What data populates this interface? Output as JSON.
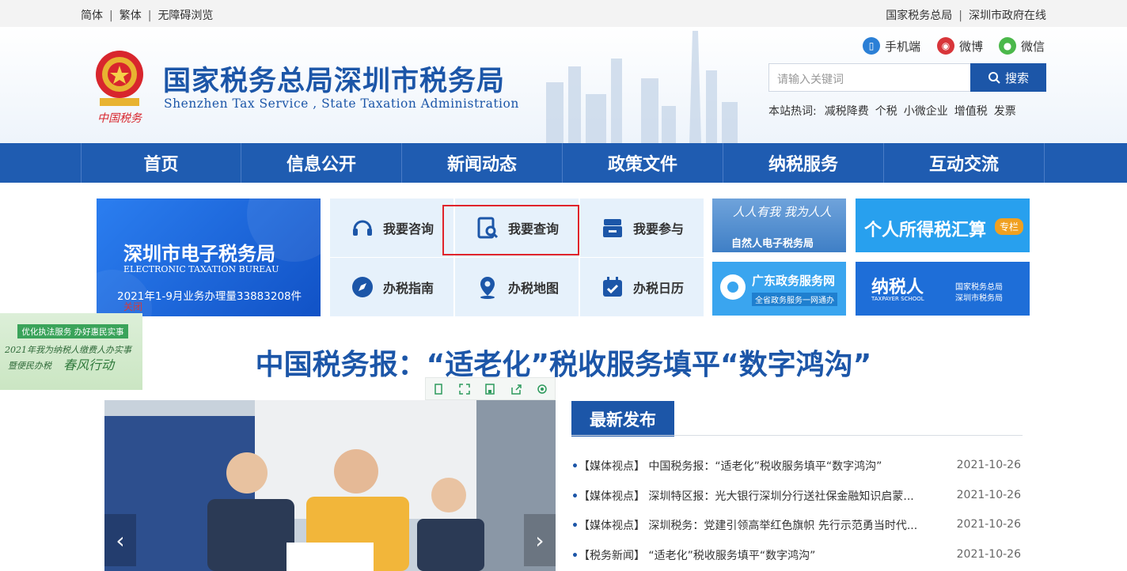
{
  "topbar": {
    "simplified": "简体",
    "traditional": "繁体",
    "accessible": "无障碍浏览",
    "sep": "|",
    "link_sat": "国家税务总局",
    "link_gov": "深圳市政府在线"
  },
  "header": {
    "title": "国家税务总局深圳市税务局",
    "subtitle": "Shenzhen  Tax  Service ,  State Taxation  Administration",
    "emblem_caption": "中国税务",
    "social": {
      "mobile": "手机端",
      "weibo": "微博",
      "wechat": "微信"
    },
    "search": {
      "placeholder": "请输入关键词",
      "button": "搜索"
    },
    "hot": {
      "label": "本站热词:",
      "keywords": [
        "减税降费",
        "个税",
        "小微企业",
        "增值税",
        "发票"
      ]
    }
  },
  "nav": [
    "首页",
    "信息公开",
    "新闻动态",
    "政策文件",
    "纳税服务",
    "互动交流"
  ],
  "ebureau": {
    "title": "深圳市电子税务局",
    "subtitle": "ELECTRONIC TAXATION BUREAU",
    "stat": "2021年1-9月业务办理量33883208件",
    "close": "关闭"
  },
  "services": [
    {
      "label": "我要咨询",
      "icon": "headset-icon"
    },
    {
      "label": "我要查询",
      "icon": "search-document-icon"
    },
    {
      "label": "我要参与",
      "icon": "ballot-box-icon"
    },
    {
      "label": "办税指南",
      "icon": "compass-icon"
    },
    {
      "label": "办税地图",
      "icon": "map-pin-icon"
    },
    {
      "label": "办税日历",
      "icon": "calendar-check-icon"
    }
  ],
  "tiles": {
    "natural_person": {
      "script": "人人有我 我为人人",
      "label": "自然人电子税务局"
    },
    "income_tax": {
      "label": "个人所得税汇算",
      "badge": "专栏"
    },
    "gd_service": {
      "title": "广东政务服务网",
      "sub": "全省政务服务一网通办"
    },
    "taxpayer_school": {
      "title": "纳税人",
      "sub_en": "TAXPAYER SCHOOL",
      "org1": "国家税务总局",
      "org2": "深圳市税务局"
    }
  },
  "float_banner": {
    "tag": "优化执法服务  办好惠民实事",
    "line1": "2021年我为纳税人缴费人办实事",
    "line2": "暨便民办税",
    "line3": "春风行动"
  },
  "headline": "中国税务报：“适老化”税收服务填平“数字鸿沟”",
  "latest": {
    "tab": "最新发布",
    "items": [
      {
        "text": "【媒体视点】 中国税务报：“适老化”税收服务填平“数字鸿沟”",
        "date": "2021-10-26"
      },
      {
        "text": "【媒体视点】 深圳特区报：光大银行深圳分行送社保金融知识启蒙...",
        "date": "2021-10-26"
      },
      {
        "text": "【媒体视点】 深圳税务：党建引领高举红色旗帜 先行示范勇当时代...",
        "date": "2021-10-26"
      },
      {
        "text": "【税务新闻】 “适老化”税收服务填平“数字鸿沟”",
        "date": "2021-10-26"
      }
    ]
  },
  "slider": {
    "prev": "‹",
    "next": "›"
  },
  "colors": {
    "brand": "#1c56a8",
    "nav": "#1f5cb1",
    "highlight": "#e0242b"
  }
}
